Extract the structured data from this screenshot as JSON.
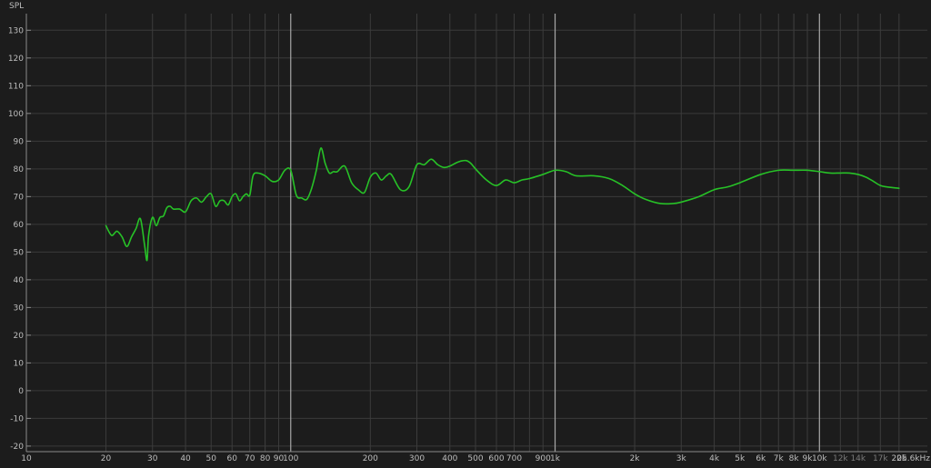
{
  "chart_data": {
    "type": "line",
    "title": "",
    "ylabel": "SPL",
    "xlabel": "",
    "x_scale": "log",
    "xlim": [
      10,
      25600
    ],
    "ylim": [
      -22,
      136
    ],
    "grid": true,
    "legend": "none",
    "y_ticks": [
      -20,
      -10,
      0,
      10,
      20,
      30,
      40,
      50,
      60,
      70,
      80,
      90,
      100,
      110,
      120,
      130
    ],
    "x_ticks": [
      {
        "value": 10,
        "label": "10",
        "major": true
      },
      {
        "value": 20,
        "label": "20",
        "major": false
      },
      {
        "value": 30,
        "label": "30",
        "major": false
      },
      {
        "value": 40,
        "label": "40",
        "major": false
      },
      {
        "value": 50,
        "label": "50",
        "major": false
      },
      {
        "value": 60,
        "label": "60",
        "major": false
      },
      {
        "value": 70,
        "label": "70",
        "major": false
      },
      {
        "value": 80,
        "label": "80",
        "major": false
      },
      {
        "value": 90,
        "label": "90",
        "major": false
      },
      {
        "value": 100,
        "label": "100",
        "major": true
      },
      {
        "value": 200,
        "label": "200",
        "major": false
      },
      {
        "value": 300,
        "label": "300",
        "major": false
      },
      {
        "value": 400,
        "label": "400",
        "major": false
      },
      {
        "value": 500,
        "label": "500",
        "major": false
      },
      {
        "value": 600,
        "label": "600",
        "major": false
      },
      {
        "value": 700,
        "label": "700",
        "major": false
      },
      {
        "value": 900,
        "label": "900",
        "major": false
      },
      {
        "value": 1000,
        "label": "1k",
        "major": true
      },
      {
        "value": 2000,
        "label": "2k",
        "major": false
      },
      {
        "value": 3000,
        "label": "3k",
        "major": false
      },
      {
        "value": 4000,
        "label": "4k",
        "major": false
      },
      {
        "value": 5000,
        "label": "5k",
        "major": false
      },
      {
        "value": 6000,
        "label": "6k",
        "major": false
      },
      {
        "value": 7000,
        "label": "7k",
        "major": false
      },
      {
        "value": 8000,
        "label": "8k",
        "major": false
      },
      {
        "value": 9000,
        "label": "9k",
        "major": false
      },
      {
        "value": 10000,
        "label": "10k",
        "major": true
      },
      {
        "value": 12000,
        "label": "12k",
        "major": false,
        "dim": true
      },
      {
        "value": 14000,
        "label": "14k",
        "major": false,
        "dim": true
      },
      {
        "value": 17000,
        "label": "17k",
        "major": false,
        "dim": true
      },
      {
        "value": 20000,
        "label": "20k",
        "major": false
      },
      {
        "value": 25600,
        "label": "25.6kHz",
        "major": false
      }
    ],
    "minor_grid_x": [
      80,
      800,
      8000
    ],
    "series": [
      {
        "color": "#27c127",
        "x": [
          20,
          21,
          22,
          23,
          24,
          25,
          26,
          27,
          28,
          28.6,
          29,
          30,
          31,
          32,
          33,
          34,
          35,
          36,
          38,
          40,
          42,
          44,
          46,
          48,
          50,
          52,
          54,
          56,
          58,
          60,
          62,
          64,
          66,
          68,
          70,
          72,
          75,
          80,
          85,
          90,
          95,
          100,
          105,
          110,
          115,
          120,
          125,
          130,
          135,
          140,
          145,
          150,
          160,
          170,
          180,
          190,
          200,
          210,
          220,
          230,
          240,
          260,
          280,
          300,
          320,
          340,
          360,
          380,
          400,
          430,
          460,
          480,
          500,
          550,
          600,
          650,
          700,
          750,
          800,
          900,
          1000,
          1100,
          1200,
          1400,
          1600,
          1800,
          2000,
          2200,
          2500,
          2800,
          3000,
          3500,
          4000,
          4500,
          5000,
          6000,
          7000,
          8000,
          9000,
          10000,
          11000,
          12000,
          13000,
          14000,
          15000,
          16000,
          17000,
          18000,
          20000
        ],
        "y": [
          59.5,
          56.0,
          57.5,
          55.5,
          52.0,
          55.5,
          58.5,
          62.0,
          52.5,
          47.0,
          56.0,
          62.5,
          59.5,
          62.5,
          63.0,
          66.0,
          66.5,
          65.5,
          65.5,
          64.5,
          68.5,
          69.5,
          68.0,
          70.0,
          71.0,
          66.5,
          68.5,
          68.5,
          67.0,
          70.0,
          71.0,
          68.5,
          70.0,
          71.0,
          70.5,
          77.5,
          78.5,
          77.5,
          75.5,
          76.0,
          79.5,
          79.5,
          70.5,
          69.5,
          69.0,
          73.0,
          79.5,
          87.5,
          82.0,
          78.5,
          79.0,
          79.0,
          81.0,
          75.0,
          72.5,
          71.5,
          77.0,
          78.5,
          76.0,
          77.5,
          78.0,
          72.5,
          73.5,
          81.5,
          81.5,
          83.5,
          81.5,
          80.5,
          81.0,
          82.5,
          83.0,
          82.0,
          80.0,
          76.0,
          74.0,
          76.0,
          75.0,
          76.0,
          76.5,
          78.0,
          79.5,
          79.0,
          77.5,
          77.5,
          76.5,
          74.0,
          71.0,
          69.0,
          67.5,
          67.5,
          68.0,
          70.0,
          72.5,
          73.5,
          75.0,
          78.0,
          79.5,
          79.5,
          79.5,
          79.0,
          78.5,
          78.5,
          78.5,
          78.0,
          77.0,
          75.5,
          74.0,
          73.5,
          73.0
        ]
      }
    ]
  }
}
